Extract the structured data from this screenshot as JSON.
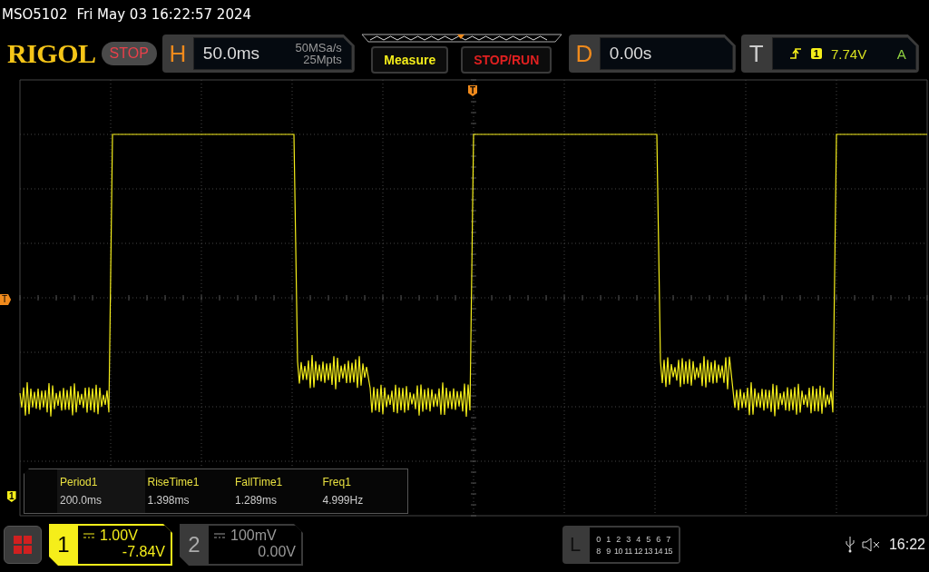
{
  "title_bar": {
    "model": "MSO5102",
    "datetime": "Fri May 03 16:22:57 2024"
  },
  "logo": "RIGOL",
  "run_state": "STOP",
  "horizontal": {
    "label": "H",
    "timebase": "50.0ms",
    "sample_rate": "50MSa/s",
    "memory_depth": "25Mpts"
  },
  "buttons": [
    {
      "label": "Measure",
      "kind": "menu"
    },
    {
      "label": "STOP/RUN",
      "kind": "run"
    }
  ],
  "delay": {
    "label": "D",
    "value": "0.00s"
  },
  "trigger": {
    "label": "T",
    "source": "1",
    "level": "7.74V",
    "mode": "A"
  },
  "markers": {
    "trigger_position": "T",
    "trigger_level": "T",
    "channel": "1"
  },
  "measurements": [
    {
      "name": "Period1",
      "value": "200.0ms"
    },
    {
      "name": "RiseTime1",
      "value": "1.398ms"
    },
    {
      "name": "FallTime1",
      "value": "1.289ms"
    },
    {
      "name": "Freq1",
      "value": "4.999Hz"
    }
  ],
  "channels": [
    {
      "number": "1",
      "scale": "1.00V",
      "offset": "-7.84V",
      "selected": true
    },
    {
      "number": "2",
      "scale": "100mV",
      "offset": "0.00V",
      "selected": false
    }
  ],
  "logic": {
    "label": "L",
    "rows": [
      [
        "0",
        "1",
        "2",
        "3",
        "4",
        "5",
        "6",
        "7"
      ],
      [
        "8",
        "9",
        "10",
        "11",
        "12",
        "13",
        "14",
        "15"
      ]
    ]
  },
  "status": {
    "time": "16:22"
  }
}
